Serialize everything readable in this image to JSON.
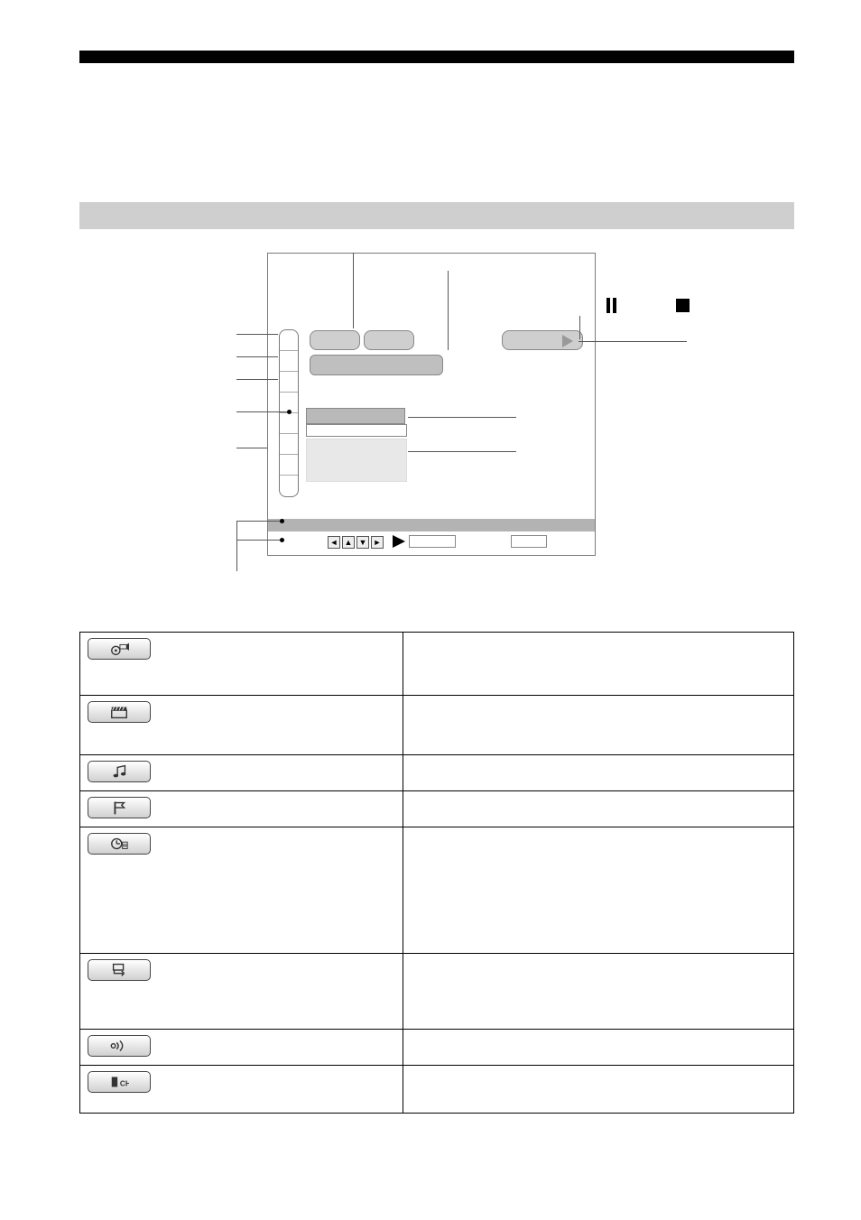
{
  "diagram": {
    "playback": {
      "play": "play",
      "pause": "pause",
      "stop": "stop"
    },
    "nav_keys": [
      "◄",
      "▲",
      "▼",
      "►"
    ]
  },
  "table": {
    "rows": [
      {
        "icon": "cam-disc-icon",
        "col1_text": "",
        "col2_text": ""
      },
      {
        "icon": "clapper-icon",
        "col1_text": "",
        "col2_text": ""
      },
      {
        "icon": "music-note-icon",
        "col1_text": "",
        "col2_text": ""
      },
      {
        "icon": "flag-icon",
        "col1_text": "",
        "col2_text": ""
      },
      {
        "icon": "clock-disc-icon",
        "col1_text": "",
        "col2_text": ""
      },
      {
        "icon": "cycle-icon",
        "col1_text": "",
        "col2_text": ""
      },
      {
        "icon": "waves-icon",
        "col1_text": "",
        "col2_text": ""
      },
      {
        "icon": "ch-icon",
        "col1_text": "",
        "col2_text": ""
      }
    ]
  }
}
